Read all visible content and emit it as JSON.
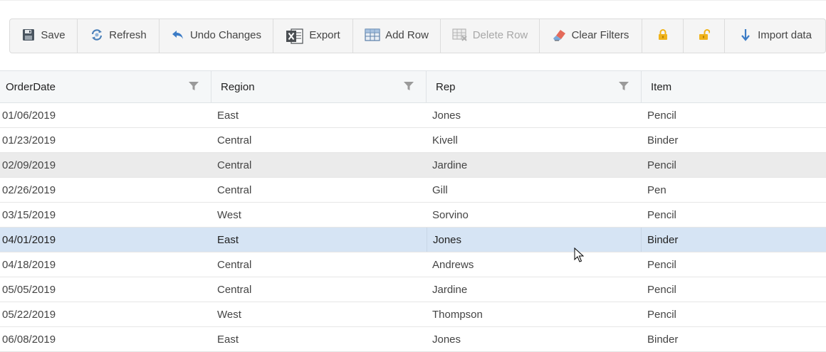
{
  "toolbar": {
    "buttons": [
      {
        "label": "Save",
        "icon": "floppy-disk-icon",
        "enabled": true
      },
      {
        "label": "Refresh",
        "icon": "refresh-icon",
        "enabled": true
      },
      {
        "label": "Undo Changes",
        "icon": "undo-arrow-icon",
        "enabled": true
      },
      {
        "label": "Export",
        "icon": "excel-icon",
        "enabled": true
      },
      {
        "label": "Add Row",
        "icon": "table-add-row-icon",
        "enabled": true
      },
      {
        "label": "Delete Row",
        "icon": "table-delete-row-icon",
        "enabled": false
      },
      {
        "label": "Clear Filters",
        "icon": "eraser-icon",
        "enabled": true
      },
      {
        "label": "",
        "icon": "lock-icon",
        "enabled": true
      },
      {
        "label": "",
        "icon": "unlock-icon",
        "enabled": true
      },
      {
        "label": "Import data",
        "icon": "down-arrow-icon",
        "enabled": true
      }
    ]
  },
  "grid": {
    "columns": [
      "OrderDate",
      "Region",
      "Rep",
      "Item"
    ],
    "rows": [
      [
        "01/06/2019",
        "East",
        "Jones",
        "Pencil"
      ],
      [
        "01/23/2019",
        "Central",
        "Kivell",
        "Binder"
      ],
      [
        "02/09/2019",
        "Central",
        "Jardine",
        "Pencil"
      ],
      [
        "02/26/2019",
        "Central",
        "Gill",
        "Pen"
      ],
      [
        "03/15/2019",
        "West",
        "Sorvino",
        "Pencil"
      ],
      [
        "04/01/2019",
        "East",
        "Jones",
        "Binder"
      ],
      [
        "04/18/2019",
        "Central",
        "Andrews",
        "Pencil"
      ],
      [
        "05/05/2019",
        "Central",
        "Jardine",
        "Pencil"
      ],
      [
        "05/22/2019",
        "West",
        "Thompson",
        "Pencil"
      ],
      [
        "06/08/2019",
        "East",
        "Jones",
        "Binder"
      ]
    ],
    "hovered_row": 2,
    "selected_row": 5
  },
  "colors": {
    "hover_row": "#ebebeb",
    "selected_row": "#d6e4f4",
    "header_bg": "#f5f7f8",
    "toolbar_bg": "#f5f5f5",
    "lock_icon": "#f0b31a",
    "accent_blue": "#3c7cc6"
  }
}
